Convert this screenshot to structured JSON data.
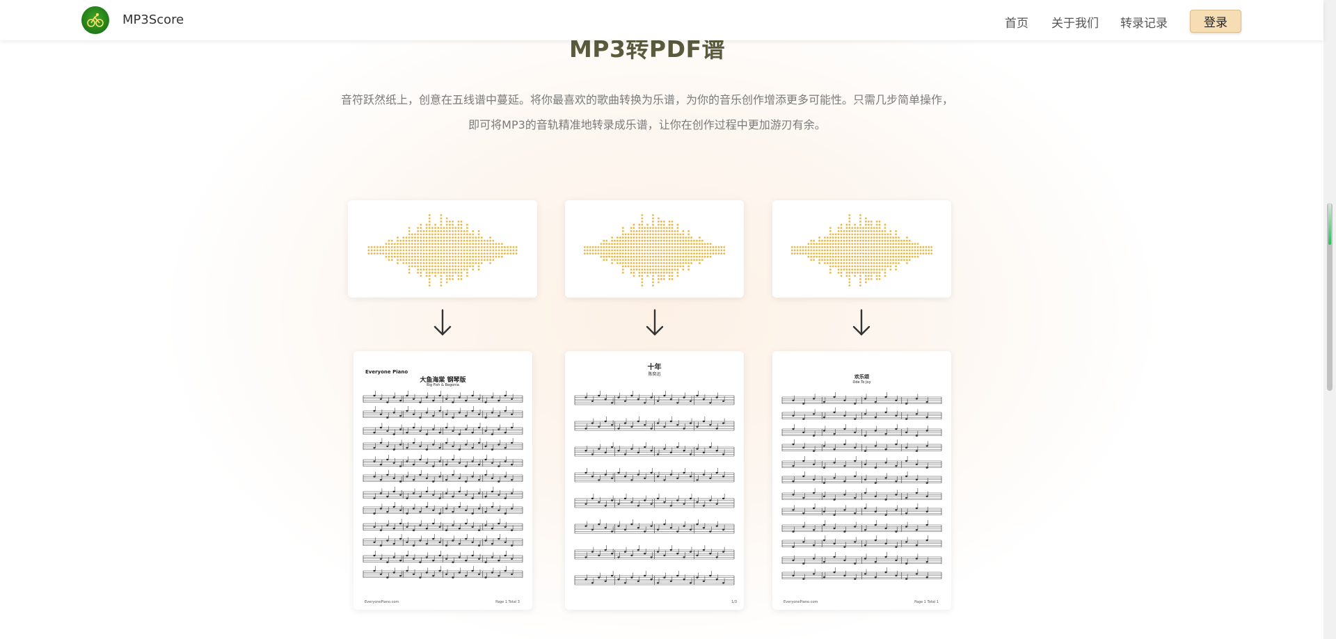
{
  "header": {
    "brand": "MP3Score",
    "nav": [
      "首页",
      "关于我们",
      "转录记录"
    ],
    "login": "登录"
  },
  "hero": {
    "title": "MP3转PDF谱",
    "line1": "音符跃然纸上，创意在五线谱中蔓延。将你最喜欢的歌曲转换为乐谱，为你的音乐创作增添更多可能性。只需几步简单操作，",
    "line2": "即可将MP3的音轨精准地转录成乐谱，让你在创作过程中更加游刃有余。"
  },
  "examples": [
    {
      "sheet_brand": "Everyone Piano",
      "sheet_title": "大鱼海棠 钢琴版",
      "sheet_subtitle": "Big Fish & Begonia",
      "sheet_footer": "EveryonePiano.com",
      "sheet_page": "Page 1 Total 3"
    },
    {
      "sheet_title": "十年",
      "sheet_subtitle": "陈奕迅",
      "sheet_footer": "",
      "sheet_page": "1/3"
    },
    {
      "sheet_title": "欢乐颂",
      "sheet_subtitle": "Ode To Joy",
      "sheet_footer": "EveryonePiano.com",
      "sheet_page": "Page 1 Total 1"
    }
  ],
  "colors": {
    "wave": "#e8b94a",
    "login_bg": "#f6ddb4",
    "title": "#5a5a3c",
    "logo_green": "#2d8a1e"
  }
}
